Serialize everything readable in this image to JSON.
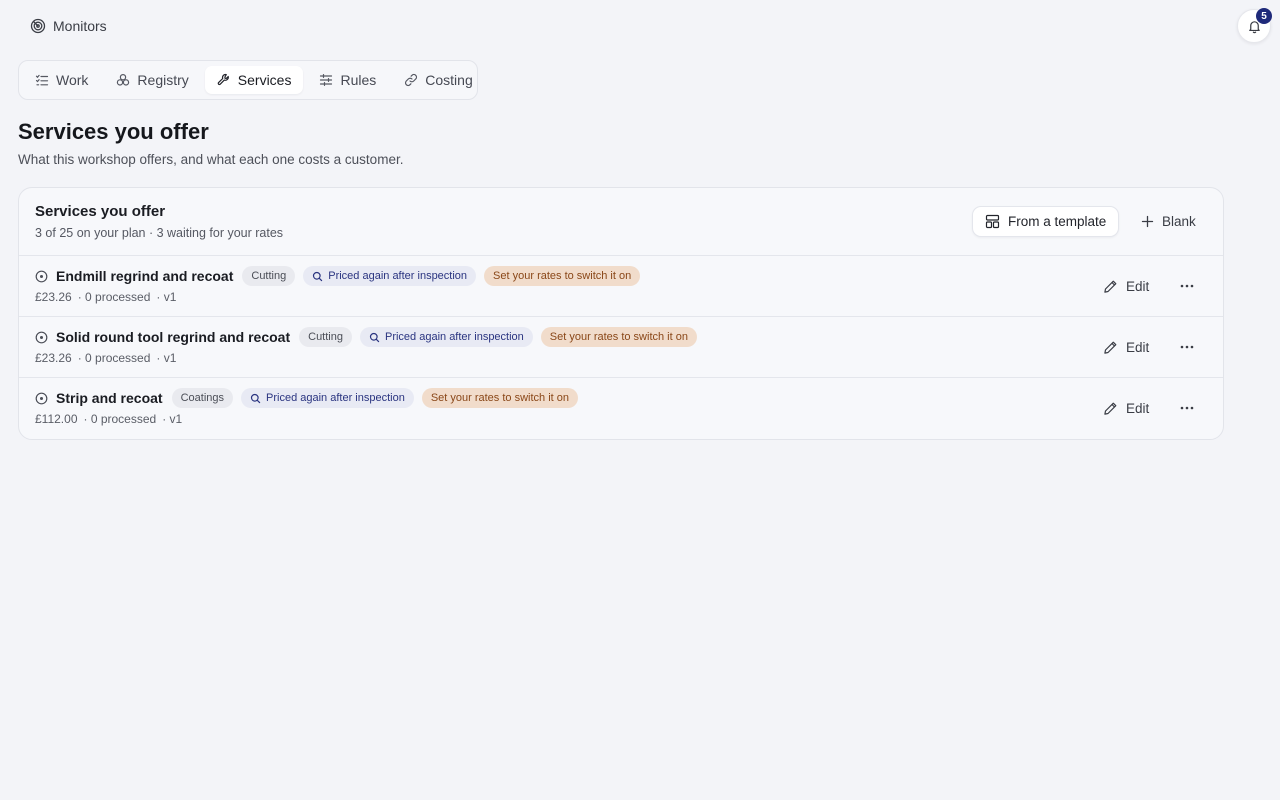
{
  "brand": {
    "label": "Monitors",
    "icon": "radar-icon"
  },
  "notifications": {
    "count": "5",
    "icon": "bell-icon"
  },
  "tabs": [
    {
      "label": "Work",
      "icon": "list-check-icon",
      "active": false
    },
    {
      "label": "Registry",
      "icon": "cubes-icon",
      "active": false
    },
    {
      "label": "Services",
      "icon": "wrench-icon",
      "active": true
    },
    {
      "label": "Rules",
      "icon": "sliders-icon",
      "active": false
    },
    {
      "label": "Costing",
      "icon": "link-icon",
      "active": false
    }
  ],
  "page": {
    "title": "Services you offer",
    "subtitle": "What this workshop offers, and what each one costs a customer."
  },
  "card": {
    "title": "Services you offer",
    "meta": "3 of 25 on your plan · 3 waiting for your rates",
    "template_button": "From a template",
    "blank_button": "Blank"
  },
  "services": [
    {
      "name": "Endmill regrind and recoat",
      "category": "Cutting",
      "info_badge": "Priced again after inspection",
      "warn_badge": "Set your rates to switch it on",
      "price": "£23.26",
      "processed": "· 0 processed",
      "version": "· v1",
      "edit_label": "Edit"
    },
    {
      "name": "Solid round tool regrind and recoat",
      "category": "Cutting",
      "info_badge": "Priced again after inspection",
      "warn_badge": "Set your rates to switch it on",
      "price": "£23.26",
      "processed": "· 0 processed",
      "version": "· v1",
      "edit_label": "Edit"
    },
    {
      "name": "Strip and recoat",
      "category": "Coatings",
      "info_badge": "Priced again after inspection",
      "warn_badge": "Set your rates to switch it on",
      "price": "£112.00",
      "processed": "· 0 processed",
      "version": "· v1",
      "edit_label": "Edit"
    }
  ],
  "colors": {
    "background": "#f3f4f8",
    "info_badge_bg": "#e8eaf4",
    "info_badge_text": "#2a3480",
    "warn_badge_bg": "#f1dccb",
    "warn_badge_text": "#8a4718",
    "notification_badge": "#1f2a7a"
  }
}
